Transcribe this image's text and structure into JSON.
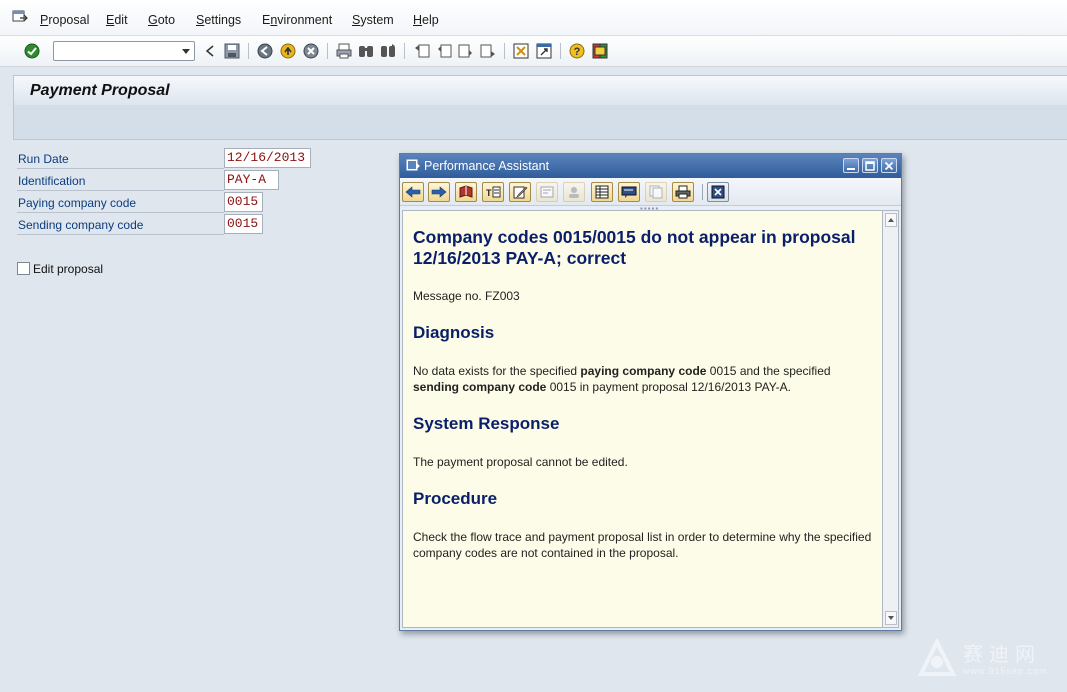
{
  "menu": {
    "items": [
      {
        "label_first": "P",
        "label_rest": "roposal"
      },
      {
        "label_first": "E",
        "label_rest": "dit"
      },
      {
        "label_first": "G",
        "label_rest": "oto"
      },
      {
        "label_first": "S",
        "label_rest": "ettings"
      },
      {
        "label_first": "",
        "label_rest": "Environment",
        "underline_index": 1
      },
      {
        "label_first": "S",
        "label_rest": "ystem"
      },
      {
        "label_first": "H",
        "label_rest": "elp"
      }
    ],
    "environment_before": "E",
    "environment_underline": "n",
    "environment_after": "vironment"
  },
  "toolbar": {
    "command_field_value": "",
    "icons": [
      "enter-icon",
      "back-icon",
      "save-icon",
      "back-nav-icon",
      "exit-icon",
      "cancel-icon",
      "print-icon",
      "find-icon",
      "find-next-icon",
      "first-page-icon",
      "previous-page-icon",
      "next-page-icon",
      "last-page-icon",
      "create-session-icon",
      "shortcut-icon",
      "help-icon",
      "layout-icon"
    ]
  },
  "page": {
    "title": "Payment Proposal"
  },
  "form": {
    "run_date": {
      "label": "Run Date",
      "value": "12/16/2013"
    },
    "identification": {
      "label": "Identification",
      "value": "PAY-A"
    },
    "paying_company_code": {
      "label": "Paying company code",
      "value": "0015"
    },
    "sending_company_code": {
      "label": "Sending company code",
      "value": "0015"
    },
    "edit_proposal": {
      "label": "Edit proposal",
      "checked": false
    }
  },
  "assistant": {
    "title": "Performance Assistant",
    "heading": "Company codes 0015/0015 do not appear in proposal 12/16/2013 PAY-A; correct",
    "message_no": "Message no. FZ003",
    "diagnosis": {
      "heading": "Diagnosis",
      "t1": "No data exists for the specified ",
      "b1": "paying company code",
      "t2": " 0015 and the specified ",
      "b2": "sending company code",
      "t3": " 0015 in payment proposal 12/16/2013 PAY-A."
    },
    "system_response": {
      "heading": "System Response",
      "text": "The payment proposal cannot be edited."
    },
    "procedure": {
      "heading": "Procedure",
      "text": "Check the flow trace and payment proposal list in order to determine why the specified company codes are not contained in the proposal."
    }
  },
  "watermark": {
    "text": "赛迪网",
    "url": "www.915sap.com"
  },
  "colors": {
    "label_blue": "#0c3d7d",
    "heading_navy": "#0a1f6a",
    "field_value_red": "#8a1010",
    "window_title_blue": "#2f5d9a"
  }
}
